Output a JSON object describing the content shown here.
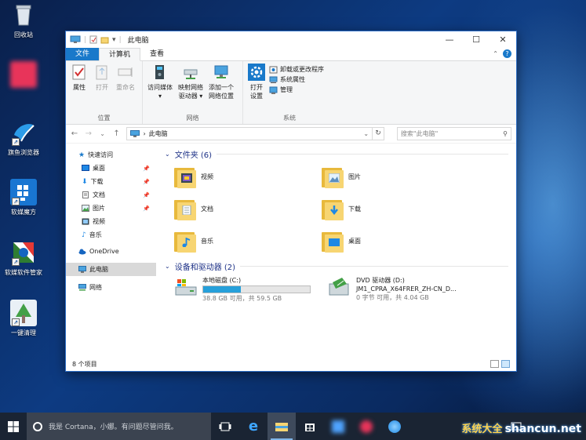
{
  "desktop": {
    "icons": [
      {
        "label": "回收站"
      },
      {
        "label": ""
      },
      {
        "label": "旗鱼浏览器"
      },
      {
        "label": "软媒魔方"
      },
      {
        "label": "软媒软件管家"
      },
      {
        "label": "一键清理"
      }
    ]
  },
  "window": {
    "title": "此电脑",
    "controls": {
      "minimize": "—",
      "maximize": "☐",
      "close": "✕"
    },
    "tabs": [
      {
        "label": "文件"
      },
      {
        "label": "计算机"
      },
      {
        "label": "查看"
      }
    ],
    "ribbon": {
      "location": {
        "label": "位置",
        "buttons": [
          {
            "label": "属性"
          },
          {
            "label": "打开"
          },
          {
            "label": "重命名"
          }
        ]
      },
      "network": {
        "label": "网络",
        "buttons": [
          {
            "label": "访问媒体",
            "arrow": "▾"
          },
          {
            "label": "映射网络\n驱动器 ▾"
          },
          {
            "label": "添加一个\n网络位置"
          }
        ]
      },
      "system": {
        "label": "系统",
        "open_settings": "打开\n设置",
        "items": [
          {
            "label": "卸载或更改程序"
          },
          {
            "label": "系统属性"
          },
          {
            "label": "管理"
          }
        ]
      }
    },
    "address": {
      "back": "←",
      "forward": "→",
      "dropdown": "⌄",
      "up": "↑",
      "separator": "›",
      "path": "此电脑",
      "refresh": "↻",
      "search_placeholder": "搜索\"此电脑\""
    },
    "navpane": [
      {
        "label": "快速访问",
        "pinned": false
      },
      {
        "label": "桌面",
        "pinned": true
      },
      {
        "label": "下载",
        "pinned": true
      },
      {
        "label": "文档",
        "pinned": true
      },
      {
        "label": "图片",
        "pinned": true
      },
      {
        "label": "视频",
        "pinned": false
      },
      {
        "label": "音乐",
        "pinned": false
      },
      {
        "label": "OneDrive",
        "pinned": false
      },
      {
        "label": "此电脑",
        "pinned": false
      },
      {
        "label": "网络",
        "pinned": false
      }
    ],
    "folders_header": "文件夹 (6)",
    "folders": [
      {
        "label": "视频"
      },
      {
        "label": "图片"
      },
      {
        "label": "文档"
      },
      {
        "label": "下载"
      },
      {
        "label": "音乐"
      },
      {
        "label": "桌面"
      }
    ],
    "drives_header": "设备和驱动器 (2)",
    "drives": [
      {
        "name": "本地磁盘 (C:)",
        "subtitle": "",
        "free": "38.8 GB 可用，共 59.5 GB",
        "used_fraction": 0.35
      },
      {
        "name": "DVD 驱动器 (D:)",
        "subtitle": "JM1_CPRA_X64FRER_ZH-CN_D...",
        "free": "0 字节 可用，共 4.04 GB"
      }
    ],
    "status": "8 个项目"
  },
  "taskbar": {
    "search_placeholder": "我是 Cortana，小娜。有问题尽管问我。"
  },
  "watermark": {
    "brand": "系统大全",
    "domain": "shancun.net"
  }
}
